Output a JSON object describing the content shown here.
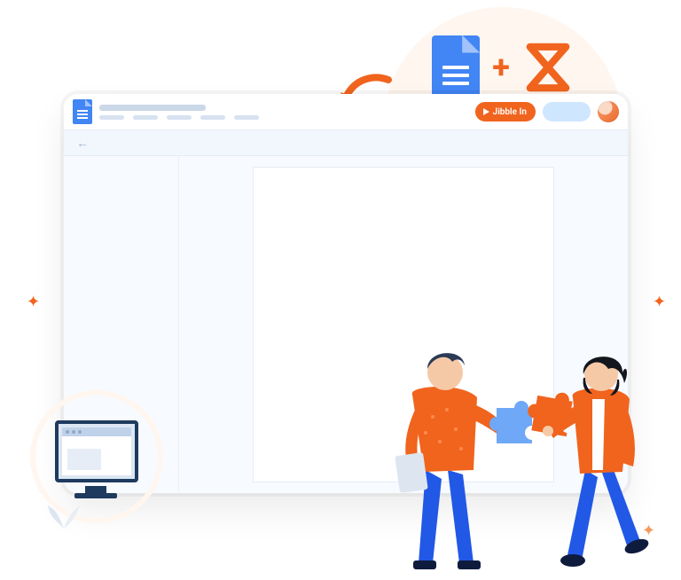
{
  "integration": {
    "plus": "+",
    "app1": "google-docs",
    "app2": "jibble"
  },
  "app": {
    "doc_title_placeholder": "",
    "jibble_button_label": "Jibble In"
  },
  "colors": {
    "accent": "#F0641E",
    "blue": "#4285F4",
    "light_blue": "#CFE6FF",
    "panel": "#F7FAFE"
  }
}
